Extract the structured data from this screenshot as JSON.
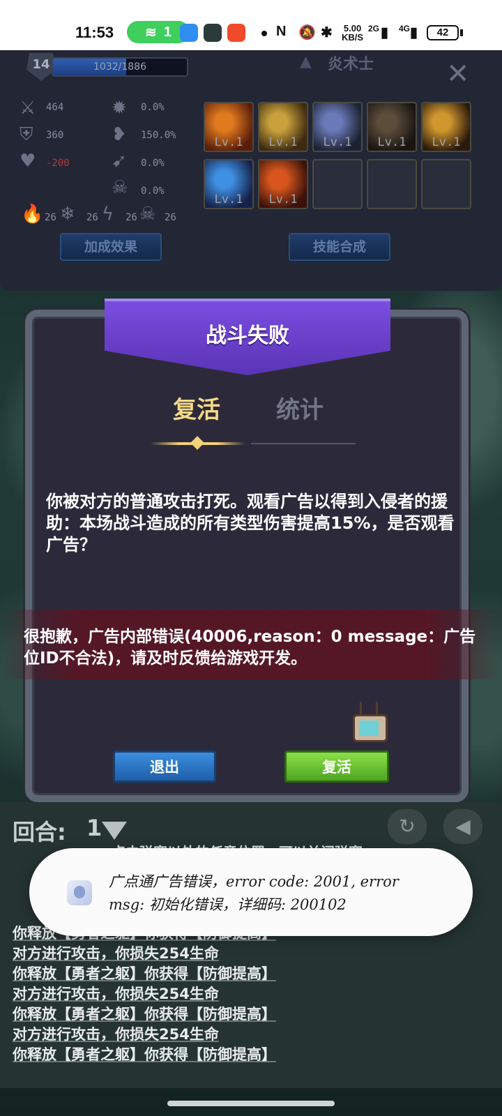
{
  "status_bar": {
    "time": "11:53",
    "hotspot_count": "1",
    "speed_value": "5.00",
    "speed_unit": "KB/S",
    "net_1": "2G",
    "net_2": "4G",
    "battery": "42"
  },
  "player": {
    "level": "14",
    "xp": "1032/1886",
    "xp_fraction": 0.547,
    "class_name": "炎术士"
  },
  "stats": {
    "attack": "464",
    "defense": "360",
    "hp": "-200",
    "crit_rate": "0.0%",
    "crit_damage": "150.0%",
    "stat_3": "0.0%",
    "stat_4": "0.0%",
    "fire_res": "26",
    "ice_res": "26",
    "lightning_res": "26",
    "poison_res": "26"
  },
  "skills": [
    {
      "level": "Lv.1",
      "color_a": "#e07a1f",
      "color_b": "#5a1e0a"
    },
    {
      "level": "Lv.1",
      "color_a": "#c9a13c",
      "color_b": "#3d2a10"
    },
    {
      "level": "Lv.1",
      "color_a": "#6a7ab8",
      "color_b": "#1d2233"
    },
    {
      "level": "Lv.1",
      "color_a": "#5c4d3b",
      "color_b": "#1a1512"
    },
    {
      "level": "Lv.1",
      "color_a": "#d0972e",
      "color_b": "#2b1a0c"
    },
    {
      "level": "Lv.1",
      "color_a": "#3f8fe3",
      "color_b": "#16224a"
    },
    {
      "level": "Lv.1",
      "color_a": "#d8561e",
      "color_b": "#3b120a"
    }
  ],
  "panel_buttons": {
    "bonus": "加成效果",
    "synthesis": "技能合成"
  },
  "dialog": {
    "title": "战斗失败",
    "tab_active": "复活",
    "tab_inactive": "统计",
    "message": "你被对方的普通攻击打死。观看广告以得到入侵者的援助：本场战斗造成的所有类型伤害提高15%，是否观看广告？",
    "error": "很抱歉，广告内部错误(40006,reason：0  message：广告位ID不合法)，请及时反馈给游戏开发。",
    "exit_label": "退出",
    "revive_label": "复活"
  },
  "battle_log": {
    "round_label": "回合:",
    "round_value": "1",
    "close_hint": "点击弹窗以外的任意位置，可以关闭弹窗",
    "lines": [
      "你释放【勇者之躯】你获得【防御提高】",
      "对方进行攻击，你损失254生命",
      "你释放【勇者之躯】你获得【防御提高】",
      "对方进行攻击，你损失254生命",
      "你释放【勇者之躯】你获得【防御提高】",
      "对方进行攻击，你损失254生命",
      "你释放【勇者之躯】你获得【防御提高】"
    ]
  },
  "toast": {
    "text": "广点通广告错误，error code: 2001, error msg: 初始化错误，详细码: 200102"
  }
}
